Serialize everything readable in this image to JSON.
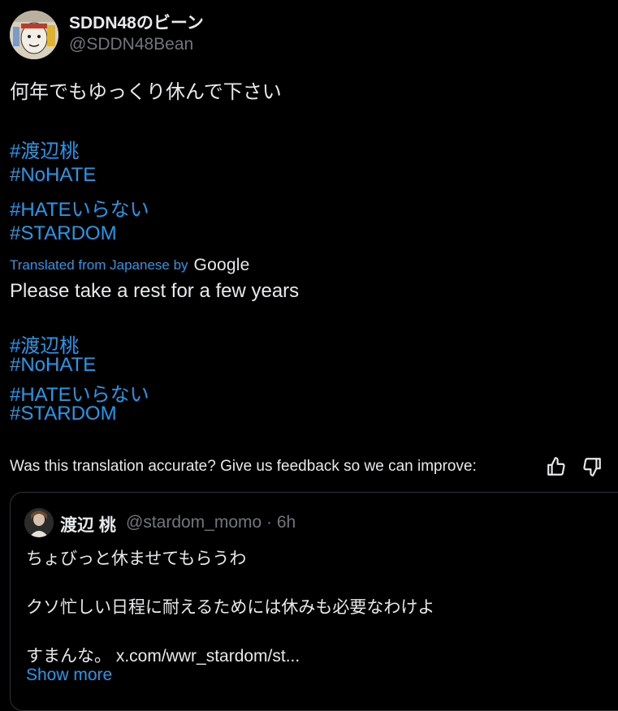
{
  "author": {
    "display_name": "SDDN48のビーン",
    "handle": "@SDDN48Bean"
  },
  "tweet": {
    "text": "何年でもゆっくり休んで下さい",
    "hashtags": [
      "#渡辺桃",
      "#NoHATE",
      "#HATEいらない",
      "#STARDOM"
    ]
  },
  "translation": {
    "label": "Translated from Japanese by",
    "provider": "Google",
    "text": "Please take a rest for a few years",
    "hashtags": [
      "#渡辺桃",
      "#NoHATE",
      "#HATEいらない",
      "#STARDOM"
    ],
    "feedback_prompt": "Was this translation accurate? Give us feedback so we can improve:"
  },
  "quote": {
    "display_name": "渡辺 桃",
    "handle_time": "@stardom_momo · 6h",
    "lines": [
      "ちょびっと休ませてもらうわ",
      "クソ忙しい日程に耐えるためには休みも必要なわけよ",
      "すまんな。"
    ],
    "link": "x.com/wwr_stardom/st...",
    "show_more": "Show more"
  },
  "icons": {
    "thumbs_up": "thumbs-up-icon",
    "thumbs_down": "thumbs-down-icon"
  },
  "colors": {
    "background": "#000000",
    "text": "#e7e9ea",
    "secondary": "#71767b",
    "link": "#1d9bf0",
    "border": "#2f3336"
  }
}
